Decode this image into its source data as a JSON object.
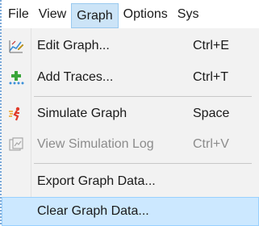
{
  "menubar": {
    "items": [
      {
        "label": "File"
      },
      {
        "label": "View"
      },
      {
        "label": "Graph"
      },
      {
        "label": "Options"
      },
      {
        "label": "Sys"
      }
    ]
  },
  "dropdown": {
    "items": [
      {
        "label": "Edit Graph...",
        "shortcut": "Ctrl+E",
        "icon": "edit-graph-icon",
        "enabled": true
      },
      {
        "label": "Add Traces...",
        "shortcut": "Ctrl+T",
        "icon": "add-traces-icon",
        "enabled": true
      },
      {
        "label": "Simulate Graph",
        "shortcut": "Space",
        "icon": "simulate-icon",
        "enabled": true
      },
      {
        "label": "View Simulation Log",
        "shortcut": "Ctrl+V",
        "icon": "simulation-log-icon",
        "enabled": false
      },
      {
        "label": "Export Graph Data...",
        "shortcut": "",
        "icon": "",
        "enabled": true
      },
      {
        "label": "Clear Graph Data...",
        "shortcut": "",
        "icon": "",
        "enabled": true,
        "highlighted": true
      }
    ]
  },
  "colors": {
    "menu_bg": "#f2f2f2",
    "highlight": "#cce8ff",
    "active_menu": "#cce4f7",
    "disabled_text": "#8c8c8c"
  }
}
